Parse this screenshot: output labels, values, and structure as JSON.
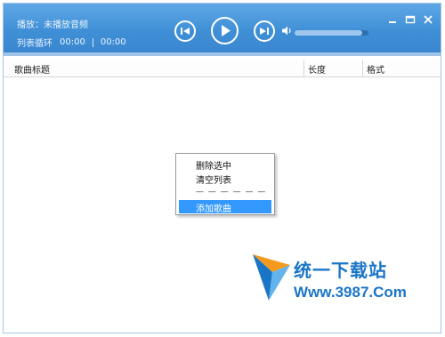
{
  "player": {
    "now_playing": "播放：未播放音频",
    "play_mode": "列表循环",
    "elapsed": "00:00",
    "duration": "00:00",
    "volume": 0.92
  },
  "controls": {
    "prev": "previous-icon",
    "play": "play-icon",
    "next": "next-icon",
    "volume": "speaker-icon"
  },
  "window_buttons": [
    "minimize-icon",
    "maximize-icon",
    "close-icon"
  ],
  "columns": [
    "歌曲标题",
    "长度",
    "格式"
  ],
  "context_menu": {
    "items": [
      "删除选中",
      "清空列表"
    ],
    "separator": "— — — — — — — —",
    "highlighted": "添加歌曲"
  },
  "watermark": {
    "title": "统一下载站",
    "url": "Www.3987.Com"
  },
  "colors": {
    "topbar": "#3f8fd6",
    "menu_highlight": "#3399ff",
    "watermark": "#1a75c6"
  }
}
